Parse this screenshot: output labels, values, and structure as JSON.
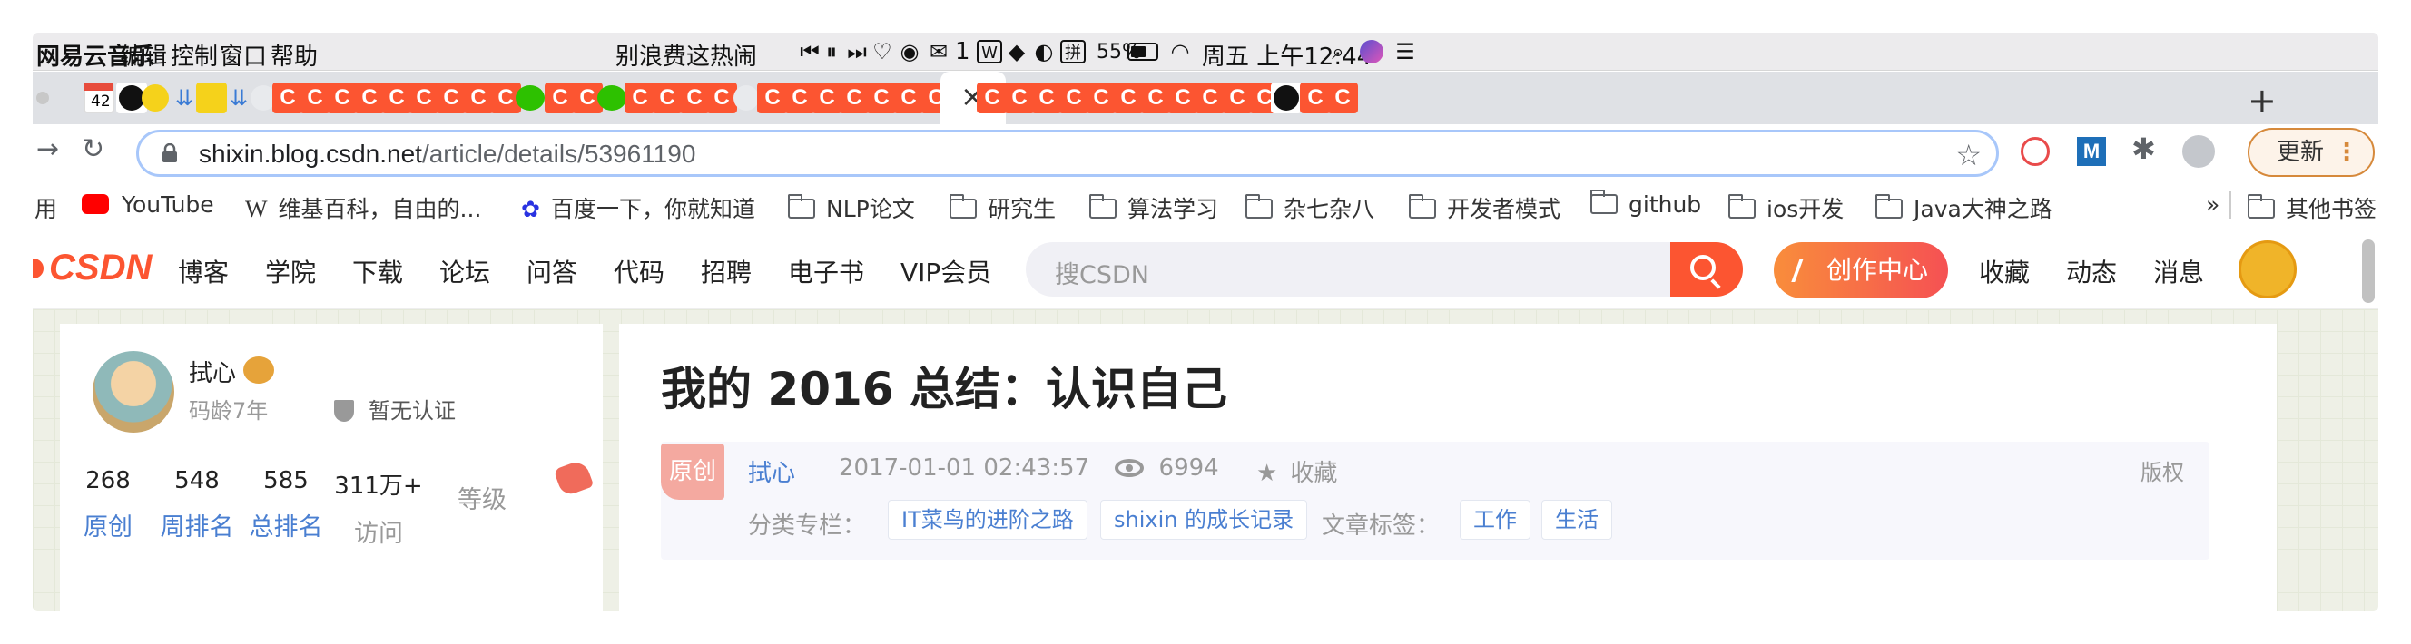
{
  "menubar": {
    "app": "网易云音乐",
    "items": [
      "编辑",
      "控制",
      "窗口",
      "帮助"
    ],
    "now_playing": "别浪费这热闹",
    "wechat_count": "1",
    "battery": "55%",
    "datetime": "周五 上午12:44"
  },
  "tabs": {
    "calendar_day": "42",
    "active_close": "×",
    "new_tab": "+"
  },
  "toolbar": {
    "url_host": "shixin.blog.csdn.net",
    "url_path": "/article/details/53961190",
    "update_label": "更新"
  },
  "bookmarks": {
    "items": [
      "用",
      "YouTube",
      "维基百科，自由的...",
      "百度一下，你就知道",
      "NLP论文",
      "研究生",
      "算法学习",
      "杂七杂八",
      "开发者模式",
      "github",
      "ios开发",
      "Java大神之路"
    ],
    "overflow": "»",
    "other": "其他书签"
  },
  "csdn": {
    "logo": "CSDN",
    "nav": [
      "博客",
      "学院",
      "下载",
      "论坛",
      "问答",
      "代码",
      "招聘",
      "电子书",
      "VIP会员"
    ],
    "search_placeholder": "搜CSDN",
    "create_label": "创作中心",
    "right_nav": [
      "收藏",
      "动态",
      "消息"
    ]
  },
  "profile": {
    "name": "拭心",
    "age": "码龄7年",
    "cert": "暂无认证",
    "stats": [
      {
        "value": "268",
        "label": "原创"
      },
      {
        "value": "548",
        "label": "周排名"
      },
      {
        "value": "585",
        "label": "总排名"
      },
      {
        "value": "311万+",
        "label": "访问"
      },
      {
        "value": "",
        "label": "等级"
      }
    ]
  },
  "article": {
    "title": "我的 2016 总结：认识自己",
    "type_tag": "原创",
    "author": "拭心",
    "date": "2017-01-01 02:43:57",
    "views": "6994",
    "favorite": "收藏",
    "rights": "版权",
    "category_label": "分类专栏：",
    "categories": [
      "IT菜鸟的进阶之路",
      "shixin 的成长记录"
    ],
    "tags_label": "文章标签：",
    "tags": [
      "工作",
      "生活"
    ]
  }
}
